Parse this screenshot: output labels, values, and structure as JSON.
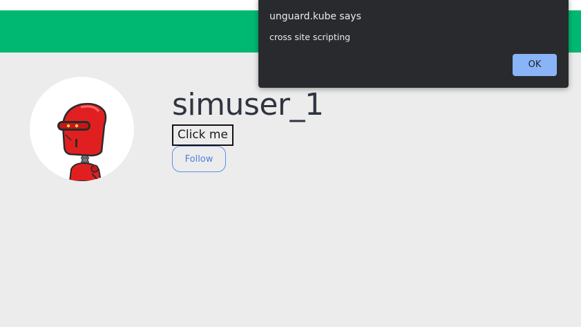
{
  "dialog": {
    "title": "unguard.kube says",
    "message": "cross site scripting",
    "ok_label": "OK"
  },
  "profile": {
    "username": "simuser_1",
    "click_label": "Click me",
    "follow_label": "Follow",
    "avatar_icon": "robot-avatar-icon"
  },
  "colors": {
    "header": "#00b872",
    "background": "#ececec",
    "dialog_bg": "#292a2d",
    "ok_button": "#8ab4f8",
    "follow_border": "#5c8de8",
    "robot_red": "#e02020"
  }
}
